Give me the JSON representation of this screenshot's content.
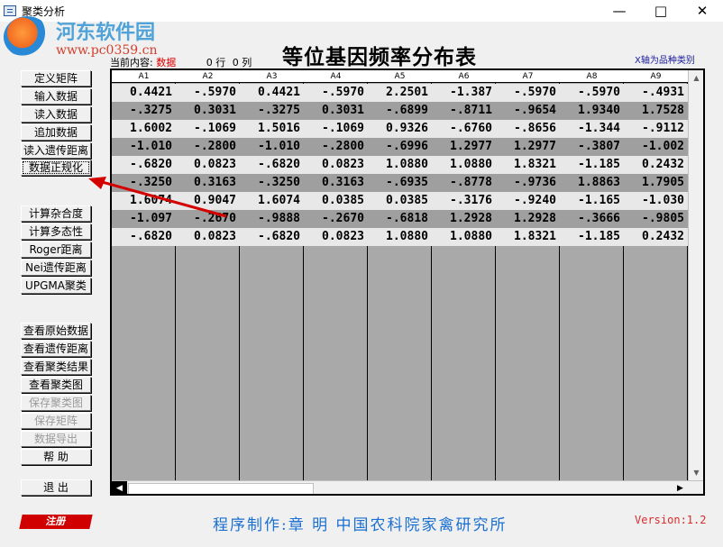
{
  "window": {
    "title": "聚类分析",
    "minimize_glyph": "—",
    "maximize_glyph": "□",
    "close_glyph": "✕"
  },
  "watermark": {
    "title": "河东软件园",
    "url": "www.pc0359.cn"
  },
  "sidebar": {
    "buttons": [
      {
        "label": "定义矩阵",
        "enabled": true
      },
      {
        "label": "输入数据",
        "enabled": true
      },
      {
        "label": "读入数据",
        "enabled": true
      },
      {
        "label": "追加数据",
        "enabled": true
      },
      {
        "label": "读入遗传距离",
        "enabled": true
      },
      {
        "label": "数据正规化",
        "enabled": true,
        "focused": true
      },
      {
        "label": "计算杂合度",
        "enabled": true
      },
      {
        "label": "计算多态性",
        "enabled": true
      },
      {
        "label": "Roger距离",
        "enabled": true
      },
      {
        "label": "Nei遗传距离",
        "enabled": true
      },
      {
        "label": "UPGMA聚类",
        "enabled": true
      },
      {
        "label": "查看原始数据",
        "enabled": true
      },
      {
        "label": "查看遗传距离",
        "enabled": true
      },
      {
        "label": "查看聚类结果",
        "enabled": true
      },
      {
        "label": "查看聚类图",
        "enabled": true
      },
      {
        "label": "保存聚类图",
        "enabled": false
      },
      {
        "label": "保存矩阵",
        "enabled": false
      },
      {
        "label": "数据导出",
        "enabled": false
      },
      {
        "label": "帮  助",
        "enabled": true
      },
      {
        "label": "退  出",
        "enabled": true
      }
    ]
  },
  "status": {
    "label": "当前内容:",
    "value": "数据",
    "rows": "0",
    "rows_unit": "行",
    "cols": "0",
    "cols_unit": "列"
  },
  "table": {
    "title": "等位基因频率分布表",
    "axis_note": "X轴为品种类别",
    "columns": [
      "A1",
      "A2",
      "A3",
      "A4",
      "A5",
      "A6",
      "A7",
      "A8",
      "A9"
    ],
    "rows": [
      [
        "0.4421",
        "-.5970",
        "0.4421",
        "-.5970",
        "2.2501",
        "-1.387",
        "-.5970",
        "-.5970",
        "-.4931"
      ],
      [
        "-.3275",
        "0.3031",
        "-.3275",
        "0.3031",
        "-.6899",
        "-.8711",
        "-.9654",
        "1.9340",
        "1.7528"
      ],
      [
        "1.6002",
        "-.1069",
        "1.5016",
        "-.1069",
        "0.9326",
        "-.6760",
        "-.8656",
        "-1.344",
        "-.9112"
      ],
      [
        "-1.010",
        "-.2800",
        "-1.010",
        "-.2800",
        "-.6996",
        "1.2977",
        "1.2977",
        "-.3807",
        "-1.002"
      ],
      [
        "-.6820",
        "0.0823",
        "-.6820",
        "0.0823",
        "1.0880",
        "1.0880",
        "1.8321",
        "-1.185",
        "0.2432"
      ],
      [
        "-.3250",
        "0.3163",
        "-.3250",
        "0.3163",
        "-.6935",
        "-.8778",
        "-.9736",
        "1.8863",
        "1.7905"
      ],
      [
        "1.6074",
        "0.9047",
        "1.6074",
        "0.0385",
        "0.0385",
        "-.3176",
        "-.9240",
        "-1.165",
        "-1.030"
      ],
      [
        "-1.097",
        "-.2670",
        "-.9888",
        "-.2670",
        "-.6818",
        "1.2928",
        "1.2928",
        "-.3666",
        "-.9805"
      ],
      [
        "-.6820",
        "0.0823",
        "-.6820",
        "0.0823",
        "1.0880",
        "1.0880",
        "1.8321",
        "-1.185",
        "0.2432"
      ]
    ]
  },
  "scrollbar": {
    "up": "▲",
    "down": "▼",
    "left": "◀",
    "right": "▶"
  },
  "footer": {
    "credit": "程序制作:章 明    中国农科院家禽研究所",
    "version": "Version:1.2",
    "register": "注册"
  },
  "colors": {
    "accent_blue": "#1a6fd1",
    "version_red": "#d92b2b",
    "status_red": "#e00000",
    "arrow_red": "#d40000"
  }
}
